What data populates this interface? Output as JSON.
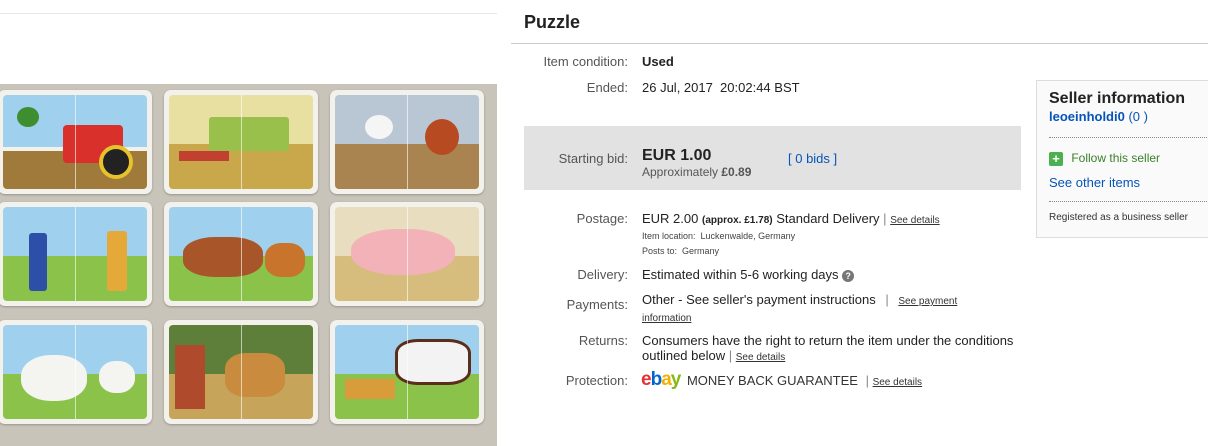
{
  "item": {
    "title": "Puzzle"
  },
  "details": {
    "condition_label": "Item condition:",
    "condition_value": "Used",
    "ended_label": "Ended:",
    "ended_value": "26 Jul, 2017  20:02:44 BST"
  },
  "bid": {
    "label": "Starting bid:",
    "amount": "EUR 1.00",
    "approx_prefix": "Approximately",
    "approx_value": "£0.89",
    "bids_link": "[ 0 bids ]"
  },
  "postage": {
    "label": "Postage:",
    "amount": "EUR 2.00",
    "approx": "(approx. £1.78)",
    "service": "Standard Delivery",
    "see_details": "See details",
    "location_label": "Item location:",
    "location_value": "Luckenwalde, Germany",
    "posts_label": "Posts to:",
    "posts_value": "Germany"
  },
  "delivery": {
    "label": "Delivery:",
    "value": "Estimated within 5-6 working days",
    "help_icon": "question-icon"
  },
  "payments": {
    "label": "Payments:",
    "value": "Other - See seller's payment instructions",
    "link_line1": "See payment",
    "link_line2": "information"
  },
  "returns": {
    "label": "Returns:",
    "line1": "Consumers have the right to return the item under the conditions",
    "line2": "outlined below",
    "see_details": "See details"
  },
  "protection": {
    "label": "Protection:",
    "logo": [
      "e",
      "b",
      "a",
      "y"
    ],
    "logo_colors": [
      "#e53238",
      "#0064d2",
      "#f5af02",
      "#86b817"
    ],
    "guarantee": "MONEY BACK GUARANTEE",
    "see_details": "See details"
  },
  "seller": {
    "heading": "Seller information",
    "username": "leoeinholdi0",
    "feedback": "(0 )",
    "follow_icon": "plus-icon",
    "follow": "Follow this seller",
    "other_items": "See other items",
    "registered": "Registered as a business seller"
  },
  "photo": {
    "alt_icon": "puzzle-photo",
    "tiles": [
      "tractor",
      "combine-harvester",
      "chickens",
      "farmers",
      "horse-and-foal",
      "pigs",
      "sheep",
      "pony-in-stable",
      "cow"
    ]
  }
}
